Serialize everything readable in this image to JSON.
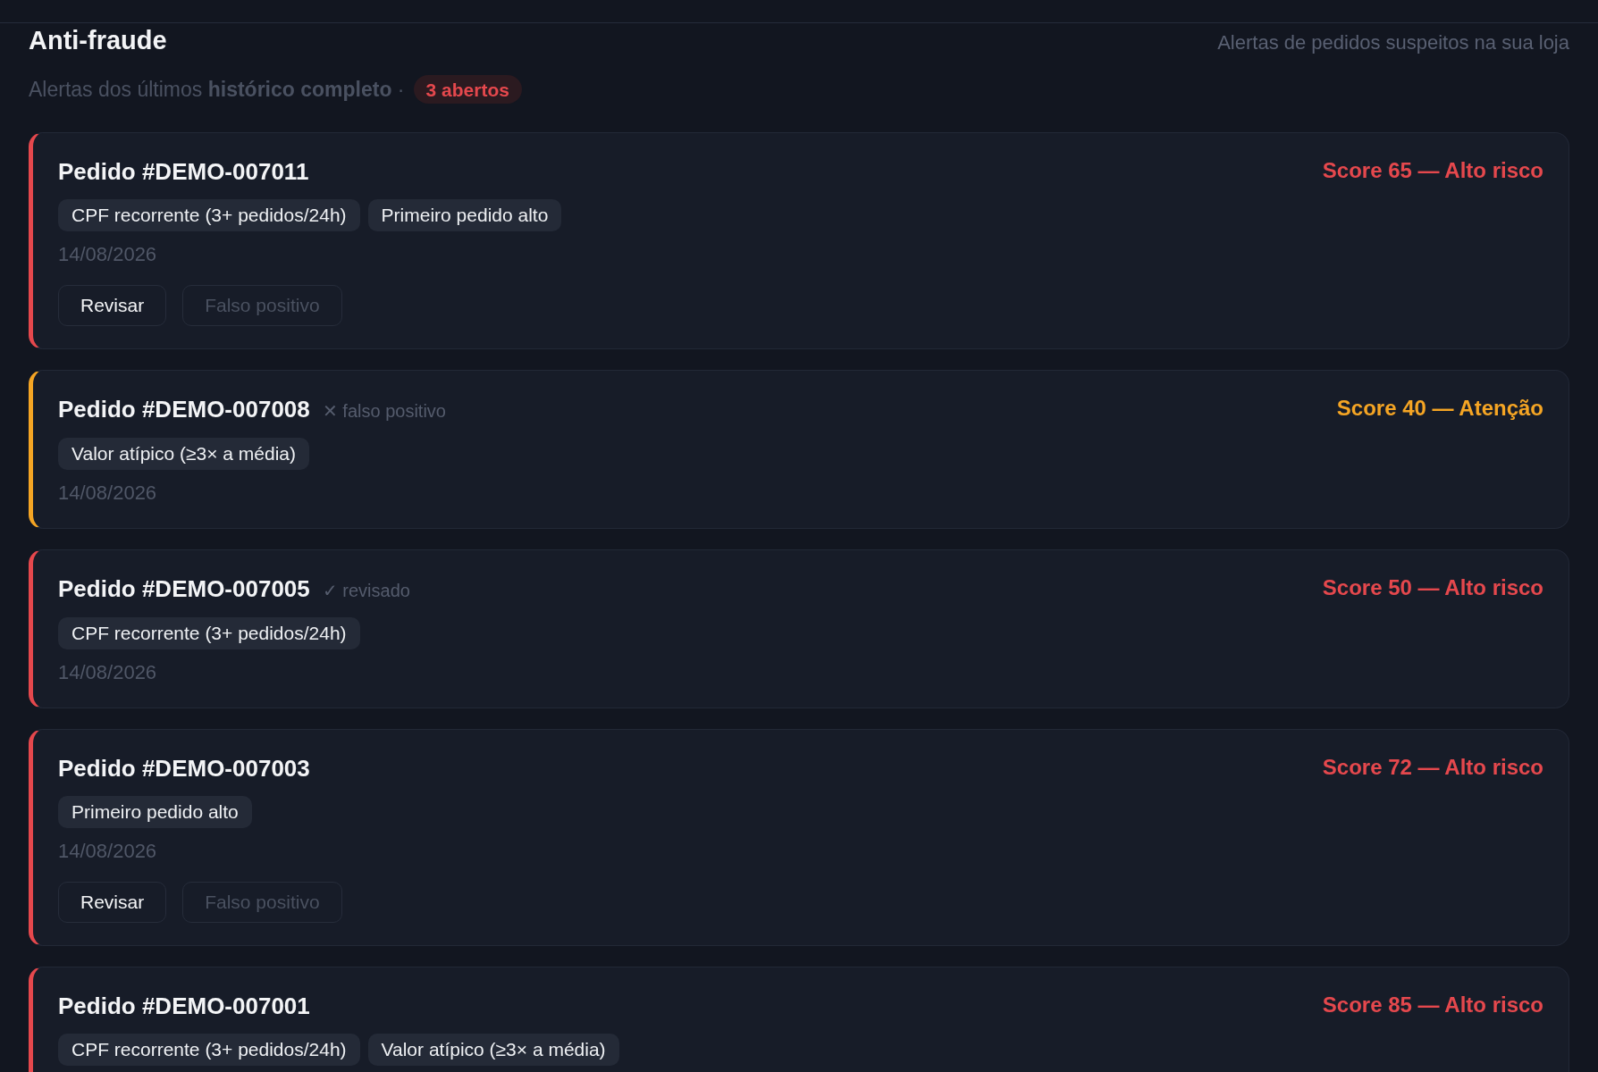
{
  "header": {
    "title": "Anti-fraude",
    "description": "Alertas de pedidos suspeitos na sua loja"
  },
  "summary": {
    "text": "Alertas dos últimos **histórico completo** ·",
    "badge": "3 abertos"
  },
  "alerts": [
    {
      "order": "Pedido #DEMO-007011",
      "color": "#e5484d",
      "score": "Score 65 — Alto risco",
      "flags": [
        "CPF recorrente (3+ pedidos/24h)",
        "Primeiro pedido alto"
      ],
      "date": "14/08/2026",
      "actions": [
        {
          "label": "Revisar",
          "disabled": false
        },
        {
          "label": "Falso positivo",
          "disabled": true
        }
      ]
    },
    {
      "order": "Pedido #DEMO-007008",
      "color": "#f5a524",
      "status_label": "✕ falso positivo",
      "score": "Score 40 — Atenção",
      "flags": [
        "Valor atípico (≥3× a média)"
      ],
      "date": "14/08/2026"
    },
    {
      "order": "Pedido #DEMO-007005",
      "color": "#e5484d",
      "status_label": "✓ revisado",
      "score": "Score 50 — Alto risco",
      "flags": [
        "CPF recorrente (3+ pedidos/24h)"
      ],
      "date": "14/08/2026"
    },
    {
      "order": "Pedido #DEMO-007003",
      "color": "#e5484d",
      "score": "Score 72 — Alto risco",
      "flags": [
        "Primeiro pedido alto"
      ],
      "date": "14/08/2026",
      "actions": [
        {
          "label": "Revisar",
          "disabled": false
        },
        {
          "label": "Falso positivo",
          "disabled": true
        }
      ]
    },
    {
      "order": "Pedido #DEMO-007001",
      "color": "#e5484d",
      "score": "Score 85 — Alto risco",
      "flags": [
        "CPF recorrente (3+ pedidos/24h)",
        "Valor atípico (≥3× a média)"
      ]
    }
  ]
}
